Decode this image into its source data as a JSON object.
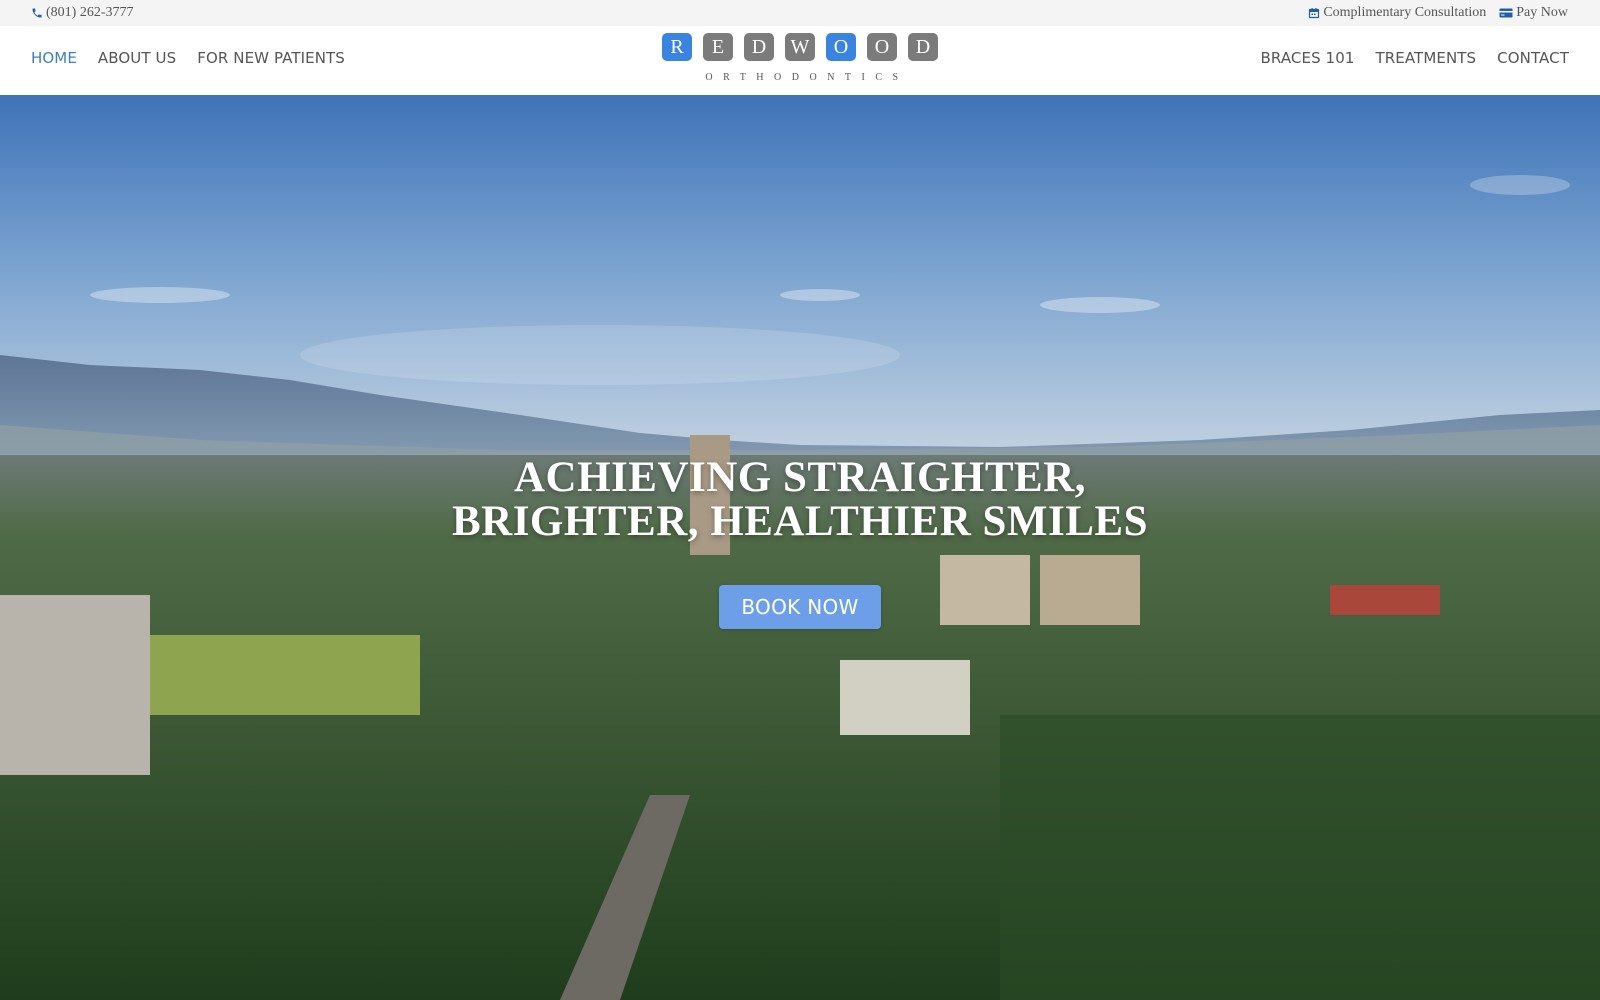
{
  "topbar": {
    "phone": {
      "icon": "phone-icon",
      "label": "(801) 262-3777"
    },
    "links": [
      {
        "icon": "calendar-icon",
        "label": "Complimentary Consultation"
      },
      {
        "icon": "credit-card-icon",
        "label": "Pay Now"
      }
    ]
  },
  "nav": {
    "left": [
      {
        "label": "HOME",
        "active": true
      },
      {
        "label": "ABOUT US",
        "active": false
      },
      {
        "label": "FOR NEW PATIENTS",
        "active": false
      }
    ],
    "right": [
      {
        "label": "BRACES 101",
        "active": false
      },
      {
        "label": "TREATMENTS",
        "active": false
      },
      {
        "label": "CONTACT",
        "active": false
      }
    ]
  },
  "logo": {
    "letters": [
      "R",
      "E",
      "D",
      "W",
      "O",
      "O",
      "D"
    ],
    "subtitle": "ORTHODONTICS",
    "colors": {
      "highlight": "#3b83e0",
      "default": "#7b7b7b"
    }
  },
  "hero": {
    "title_line1": "ACHIEVING STRAIGHTER,",
    "title_line2": "BRIGHTER, HEALTHIER SMILES",
    "cta_label": "BOOK NOW",
    "background": "aerial-city-mountain-image"
  },
  "colors": {
    "accent": "#3d7fc4",
    "button": "#6d9ee8",
    "topbar_bg": "#f5f4f4",
    "nav_text": "#555555"
  }
}
